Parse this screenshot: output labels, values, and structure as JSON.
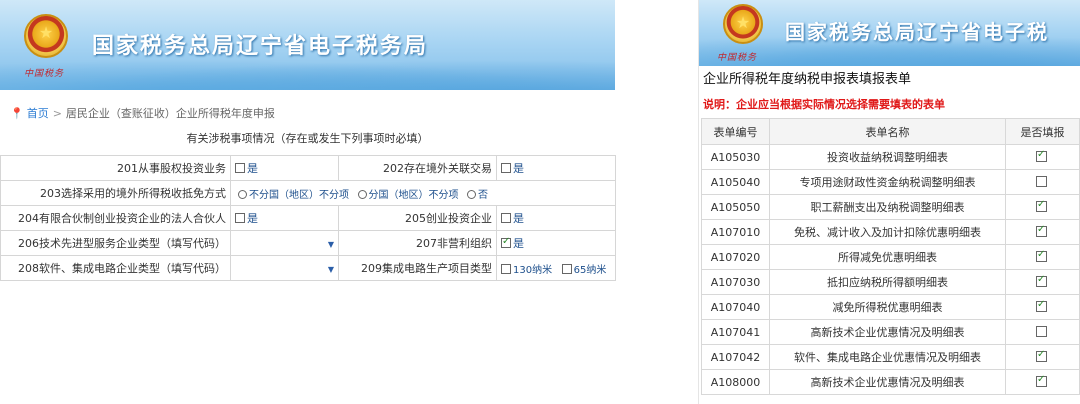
{
  "banner": {
    "title": "国家税务总局辽宁省电子税务局",
    "script": "中国税务"
  },
  "breadcrumb": {
    "home": "首页",
    "trail": "居民企业（查账征收）企业所得税年度申报"
  },
  "section_title": "有关涉税事项情况（存在或发生下列事项时必填）",
  "form": {
    "r1": {
      "l1": "201从事股权投资业务",
      "v1": "是",
      "l2": "202存在境外关联交易",
      "v2": "是"
    },
    "r2": {
      "l1": "203选择采用的境外所得税收抵免方式",
      "o1": "不分国（地区）不分项",
      "o2": "分国（地区）不分项",
      "o3": "否"
    },
    "r3": {
      "l1": "204有限合伙制创业投资企业的法人合伙人",
      "v1": "是",
      "l2": "205创业投资企业",
      "v2": "是"
    },
    "r4": {
      "l1": "206技术先进型服务企业类型（填写代码）",
      "l2": "207非营利组织",
      "v2": "是"
    },
    "r5": {
      "l1": "208软件、集成电路企业类型（填写代码）",
      "l2": "209集成电路生产项目类型",
      "o1": "130纳米",
      "o2": "65纳米"
    }
  },
  "right": {
    "banner_title": "国家税务总局辽宁省电子税",
    "title": "企业所得税年度纳税申报表填报表单",
    "note": "说明：企业应当根据实际情况选择需要填表的表单",
    "headers": {
      "code": "表单编号",
      "name": "表单名称",
      "fill": "是否填报"
    },
    "rows": [
      {
        "code": "A105030",
        "name": "投资收益纳税调整明细表",
        "checked": true
      },
      {
        "code": "A105040",
        "name": "专项用途财政性资金纳税调整明细表",
        "checked": false
      },
      {
        "code": "A105050",
        "name": "职工薪酬支出及纳税调整明细表",
        "checked": true
      },
      {
        "code": "A107010",
        "name": "免税、减计收入及加计扣除优惠明细表",
        "checked": true
      },
      {
        "code": "A107020",
        "name": "所得减免优惠明细表",
        "checked": true
      },
      {
        "code": "A107030",
        "name": "抵扣应纳税所得额明细表",
        "checked": true
      },
      {
        "code": "A107040",
        "name": "减免所得税优惠明细表",
        "checked": true
      },
      {
        "code": "A107041",
        "name": "高新技术企业优惠情况及明细表",
        "checked": false
      },
      {
        "code": "A107042",
        "name": "软件、集成电路企业优惠情况及明细表",
        "checked": true
      },
      {
        "code": "A108000",
        "name": "高新技术企业优惠情况及明细表",
        "checked": true
      }
    ]
  }
}
